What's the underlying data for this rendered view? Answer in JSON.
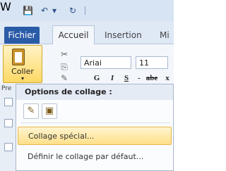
{
  "title_bar": {
    "app_letter": "W",
    "qat": {
      "save_glyph": "💾",
      "undo_glyph": "↶",
      "redo_glyph": "↻",
      "dropdown_glyph": "▾"
    }
  },
  "tabs": [
    {
      "label": "Fichier"
    },
    {
      "label": "Accueil"
    },
    {
      "label": "Insertion"
    },
    {
      "label": "Mi"
    }
  ],
  "ribbon": {
    "paste_label": "Coller",
    "paste_arrow": "▾",
    "font_name": "Ariai",
    "font_size": "11",
    "format": {
      "bold": "G",
      "italic": "I",
      "underline": "S",
      "separator": "-",
      "strike": "abe",
      "sub": "x"
    }
  },
  "left_strip": {
    "label": "Pre"
  },
  "paste_menu": {
    "header": "Options de collage :",
    "items": [
      {
        "label": "Collage spécial..."
      },
      {
        "label": "Définir le collage par défaut..."
      }
    ]
  },
  "colors": {
    "accent": "#2a5ba7",
    "highlight": "#ffe08a"
  }
}
